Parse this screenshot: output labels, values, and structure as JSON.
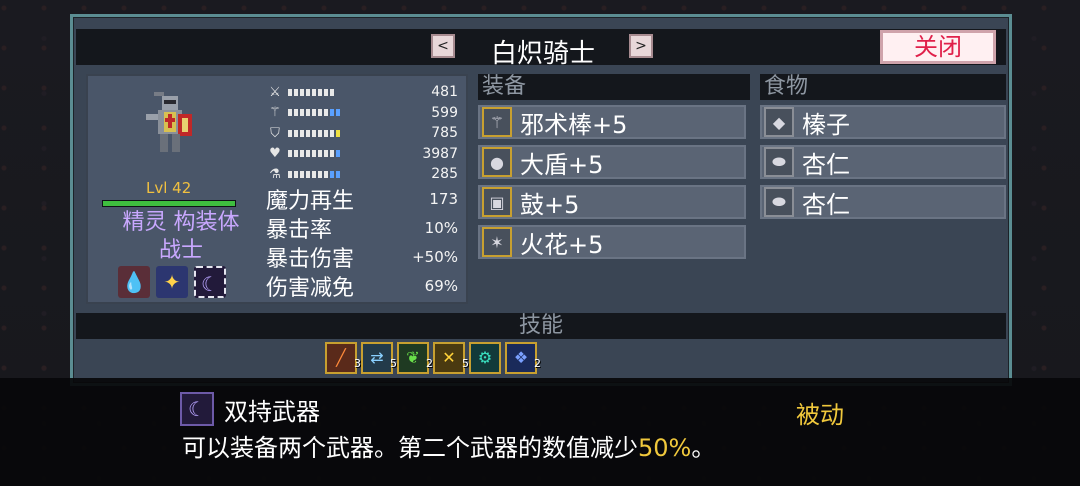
{
  "window": {
    "title": "白炽骑士",
    "prev_label": "<",
    "next_label": ">",
    "close_label": "关闭"
  },
  "character": {
    "level": "Lvl 42",
    "race_line1": "精灵 构装体",
    "race_line2": "战士",
    "hp_fill_fraction": 1.0
  },
  "stats": [
    {
      "icon": "sword-icon",
      "value": "481"
    },
    {
      "icon": "staff-icon",
      "value": "599"
    },
    {
      "icon": "shield-icon",
      "value": "785"
    },
    {
      "icon": "heart-icon",
      "value": "3987"
    },
    {
      "icon": "flask-icon",
      "value": "285"
    }
  ],
  "sub_stats": [
    {
      "label": "魔力再生",
      "value": "173"
    },
    {
      "label": "暴击率",
      "value": "10%"
    },
    {
      "label": "暴击伤害",
      "value": "+50%"
    },
    {
      "label": "伤害减免",
      "value": "69%"
    }
  ],
  "equipment": {
    "header": "装备",
    "items": [
      {
        "label": "邪术棒+5",
        "icon": "wand-icon"
      },
      {
        "label": "大盾+5",
        "icon": "round-shield-icon"
      },
      {
        "label": "鼓+5",
        "icon": "drum-icon"
      },
      {
        "label": "火花+5",
        "icon": "spark-icon"
      }
    ]
  },
  "food": {
    "header": "食物",
    "items": [
      {
        "label": "榛子",
        "icon": "hazelnut-icon"
      },
      {
        "label": "杏仁",
        "icon": "almond-icon"
      },
      {
        "label": "杏仁",
        "icon": "almond-icon"
      }
    ]
  },
  "skills": {
    "header": "技能",
    "items": [
      {
        "icon": "slash-icon",
        "count": "3"
      },
      {
        "icon": "swap-icon",
        "count": "5"
      },
      {
        "icon": "leaf-icon",
        "count": "2"
      },
      {
        "icon": "cross-blades-icon",
        "count": "5"
      },
      {
        "icon": "gear-ring-icon",
        "count": ""
      },
      {
        "icon": "rune-icon",
        "count": "2"
      }
    ]
  },
  "tooltip": {
    "name": "双持武器",
    "type": "被动",
    "desc_before": "可以装备两个武器。第二个武器的数值减少",
    "desc_highlight": "50%",
    "desc_after": "。"
  },
  "colors": {
    "panel_border": "#5b8d92",
    "panel_bg": "#3a4554",
    "gold": "#f0c83c",
    "purple": "#c9a8ff",
    "close_text": "#e0204a"
  }
}
